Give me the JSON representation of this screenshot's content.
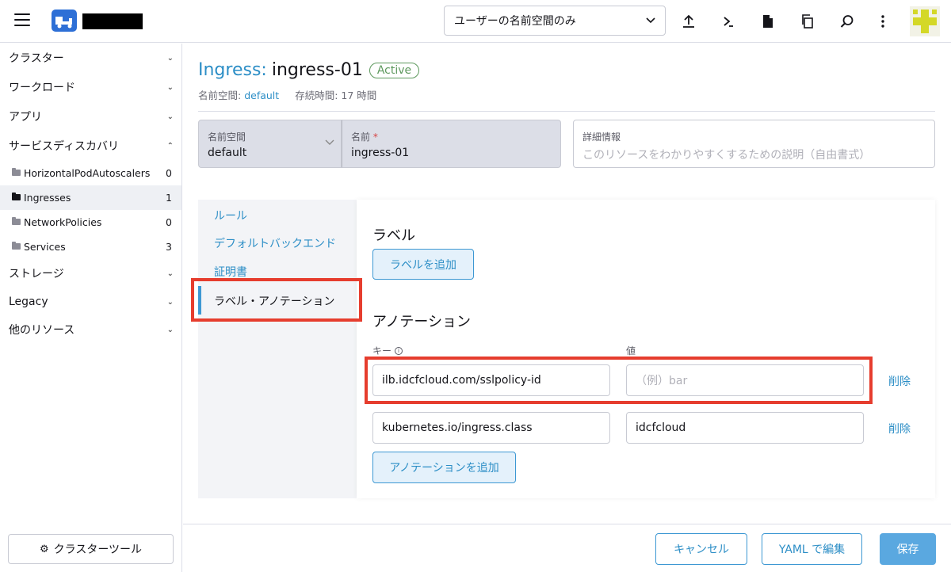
{
  "header": {
    "namespace_filter": "ユーザーの名前空間のみ",
    "icons": [
      "upload-icon",
      "terminal-icon",
      "file-icon",
      "copy-icon",
      "search-icon",
      "more-vert-icon"
    ]
  },
  "sidebar": {
    "groups": [
      {
        "label": "クラスター",
        "state": "collapsed"
      },
      {
        "label": "ワークロード",
        "state": "collapsed"
      },
      {
        "label": "アプリ",
        "state": "collapsed"
      },
      {
        "label": "サービスディスカバリ",
        "state": "expanded"
      }
    ],
    "items": [
      {
        "label": "HorizontalPodAutoscalers",
        "count": "0"
      },
      {
        "label": "Ingresses",
        "count": "1"
      },
      {
        "label": "NetworkPolicies",
        "count": "0"
      },
      {
        "label": "Services",
        "count": "3"
      }
    ],
    "groups2": [
      {
        "label": "ストレージ"
      },
      {
        "label": "Legacy"
      },
      {
        "label": "他のリソース"
      }
    ],
    "cluster_tools": "クラスターツール"
  },
  "resource": {
    "kind": "Ingress:",
    "name": "ingress-01",
    "status": "Active",
    "namespace_label": "名前空間:",
    "namespace": "default",
    "age_label": "存続時間:",
    "age": "17 時間"
  },
  "form": {
    "namespace_label": "名前空間",
    "namespace_value": "default",
    "name_label": "名前",
    "name_required": "*",
    "name_value": "ingress-01",
    "detail_label": "詳細情報",
    "detail_placeholder": "このリソースをわかりやすくするための説明（自由書式）"
  },
  "tabs": [
    "ルール",
    "デフォルトバックエンド",
    "証明書",
    "ラベル・アノテーション"
  ],
  "labels_section": {
    "title": "ラベル",
    "add_button": "ラベルを追加"
  },
  "annotations_section": {
    "title": "アノテーション",
    "key_header": "キー",
    "value_header": "値",
    "rows": [
      {
        "key": "ilb.idcfcloud.com/sslpolicy-id",
        "value": "",
        "value_placeholder": "（例）bar",
        "remove": "削除"
      },
      {
        "key": "kubernetes.io/ingress.class",
        "value": "idcfcloud",
        "remove": "削除"
      }
    ],
    "add_button": "アノテーションを追加"
  },
  "footer": {
    "cancel": "キャンセル",
    "edit_yaml": "YAML で編集",
    "save": "保存"
  },
  "colors": {
    "accent": "#2c8ec6",
    "highlight": "#e63d2e",
    "active_green": "#5d995d"
  }
}
